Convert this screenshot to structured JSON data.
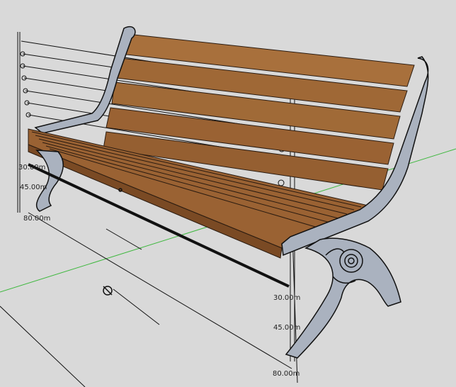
{
  "viewport": {
    "background": "#d9d9d9",
    "wood_color": "#9a6233",
    "wood_light": "#b27840",
    "metal_color": "#aab2bf",
    "metal_dark": "#5e6573",
    "axis_green": "#3fb83f"
  },
  "dimensions": {
    "left_upper": "30.00m",
    "left_middle": "45.00m",
    "left_lower": "80.00m",
    "right_upper": "30.00m",
    "right_middle": "45.00m",
    "right_lower": "80.00m"
  }
}
